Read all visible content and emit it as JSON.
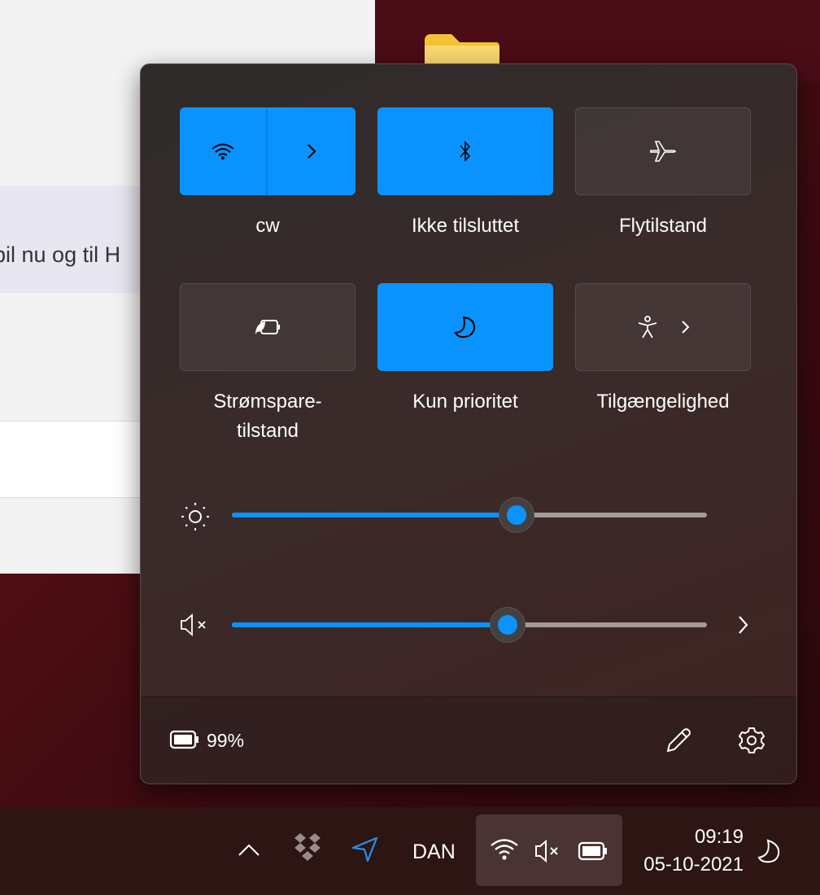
{
  "background_window": {
    "snippet": "bil nu og til H"
  },
  "quick_settings": {
    "tiles": [
      {
        "label": "cw",
        "icon": "wifi-icon",
        "active": true
      },
      {
        "label": "Ikke tilsluttet",
        "icon": "bluetooth-icon",
        "active": true
      },
      {
        "label": "Flytilstand",
        "icon": "airplane-icon",
        "active": false
      },
      {
        "label": "Strømspare-",
        "label2": "tilstand",
        "icon": "battery-saver-icon",
        "active": false
      },
      {
        "label": "Kun prioritet",
        "icon": "moon-icon",
        "active": true
      },
      {
        "label": "Tilgængelighed",
        "icon": "accessibility-icon",
        "active": false
      }
    ],
    "brightness_percent": 60,
    "volume_percent": 58,
    "volume_muted": true,
    "battery": "99%"
  },
  "taskbar": {
    "language": "DAN",
    "time": "09:19",
    "date": "05-10-2021"
  },
  "colors": {
    "accent": "#0a93ff"
  }
}
